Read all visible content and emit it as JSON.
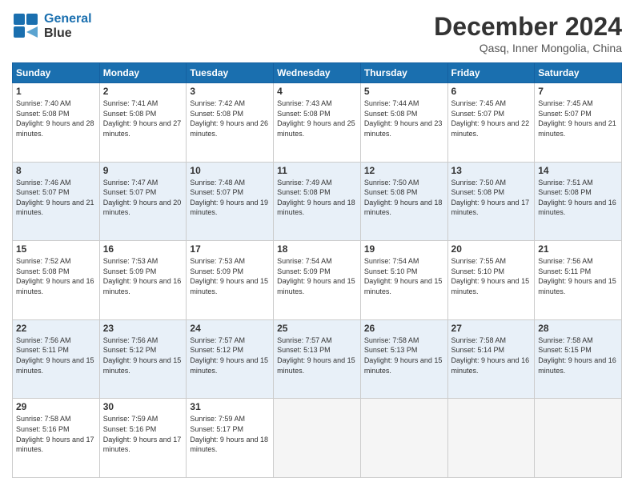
{
  "header": {
    "logo_line1": "General",
    "logo_line2": "Blue",
    "title": "December 2024",
    "location": "Qasq, Inner Mongolia, China"
  },
  "days_of_week": [
    "Sunday",
    "Monday",
    "Tuesday",
    "Wednesday",
    "Thursday",
    "Friday",
    "Saturday"
  ],
  "weeks": [
    [
      {
        "day": 1,
        "sunrise": "7:40 AM",
        "sunset": "5:08 PM",
        "daylight": "9 hours and 28 minutes."
      },
      {
        "day": 2,
        "sunrise": "7:41 AM",
        "sunset": "5:08 PM",
        "daylight": "9 hours and 27 minutes."
      },
      {
        "day": 3,
        "sunrise": "7:42 AM",
        "sunset": "5:08 PM",
        "daylight": "9 hours and 26 minutes."
      },
      {
        "day": 4,
        "sunrise": "7:43 AM",
        "sunset": "5:08 PM",
        "daylight": "9 hours and 25 minutes."
      },
      {
        "day": 5,
        "sunrise": "7:44 AM",
        "sunset": "5:08 PM",
        "daylight": "9 hours and 23 minutes."
      },
      {
        "day": 6,
        "sunrise": "7:45 AM",
        "sunset": "5:07 PM",
        "daylight": "9 hours and 22 minutes."
      },
      {
        "day": 7,
        "sunrise": "7:45 AM",
        "sunset": "5:07 PM",
        "daylight": "9 hours and 21 minutes."
      }
    ],
    [
      {
        "day": 8,
        "sunrise": "7:46 AM",
        "sunset": "5:07 PM",
        "daylight": "9 hours and 21 minutes."
      },
      {
        "day": 9,
        "sunrise": "7:47 AM",
        "sunset": "5:07 PM",
        "daylight": "9 hours and 20 minutes."
      },
      {
        "day": 10,
        "sunrise": "7:48 AM",
        "sunset": "5:07 PM",
        "daylight": "9 hours and 19 minutes."
      },
      {
        "day": 11,
        "sunrise": "7:49 AM",
        "sunset": "5:08 PM",
        "daylight": "9 hours and 18 minutes."
      },
      {
        "day": 12,
        "sunrise": "7:50 AM",
        "sunset": "5:08 PM",
        "daylight": "9 hours and 18 minutes."
      },
      {
        "day": 13,
        "sunrise": "7:50 AM",
        "sunset": "5:08 PM",
        "daylight": "9 hours and 17 minutes."
      },
      {
        "day": 14,
        "sunrise": "7:51 AM",
        "sunset": "5:08 PM",
        "daylight": "9 hours and 16 minutes."
      }
    ],
    [
      {
        "day": 15,
        "sunrise": "7:52 AM",
        "sunset": "5:08 PM",
        "daylight": "9 hours and 16 minutes."
      },
      {
        "day": 16,
        "sunrise": "7:53 AM",
        "sunset": "5:09 PM",
        "daylight": "9 hours and 16 minutes."
      },
      {
        "day": 17,
        "sunrise": "7:53 AM",
        "sunset": "5:09 PM",
        "daylight": "9 hours and 15 minutes."
      },
      {
        "day": 18,
        "sunrise": "7:54 AM",
        "sunset": "5:09 PM",
        "daylight": "9 hours and 15 minutes."
      },
      {
        "day": 19,
        "sunrise": "7:54 AM",
        "sunset": "5:10 PM",
        "daylight": "9 hours and 15 minutes."
      },
      {
        "day": 20,
        "sunrise": "7:55 AM",
        "sunset": "5:10 PM",
        "daylight": "9 hours and 15 minutes."
      },
      {
        "day": 21,
        "sunrise": "7:56 AM",
        "sunset": "5:11 PM",
        "daylight": "9 hours and 15 minutes."
      }
    ],
    [
      {
        "day": 22,
        "sunrise": "7:56 AM",
        "sunset": "5:11 PM",
        "daylight": "9 hours and 15 minutes."
      },
      {
        "day": 23,
        "sunrise": "7:56 AM",
        "sunset": "5:12 PM",
        "daylight": "9 hours and 15 minutes."
      },
      {
        "day": 24,
        "sunrise": "7:57 AM",
        "sunset": "5:12 PM",
        "daylight": "9 hours and 15 minutes."
      },
      {
        "day": 25,
        "sunrise": "7:57 AM",
        "sunset": "5:13 PM",
        "daylight": "9 hours and 15 minutes."
      },
      {
        "day": 26,
        "sunrise": "7:58 AM",
        "sunset": "5:13 PM",
        "daylight": "9 hours and 15 minutes."
      },
      {
        "day": 27,
        "sunrise": "7:58 AM",
        "sunset": "5:14 PM",
        "daylight": "9 hours and 16 minutes."
      },
      {
        "day": 28,
        "sunrise": "7:58 AM",
        "sunset": "5:15 PM",
        "daylight": "9 hours and 16 minutes."
      }
    ],
    [
      {
        "day": 29,
        "sunrise": "7:58 AM",
        "sunset": "5:16 PM",
        "daylight": "9 hours and 17 minutes."
      },
      {
        "day": 30,
        "sunrise": "7:59 AM",
        "sunset": "5:16 PM",
        "daylight": "9 hours and 17 minutes."
      },
      {
        "day": 31,
        "sunrise": "7:59 AM",
        "sunset": "5:17 PM",
        "daylight": "9 hours and 18 minutes."
      },
      null,
      null,
      null,
      null
    ]
  ]
}
